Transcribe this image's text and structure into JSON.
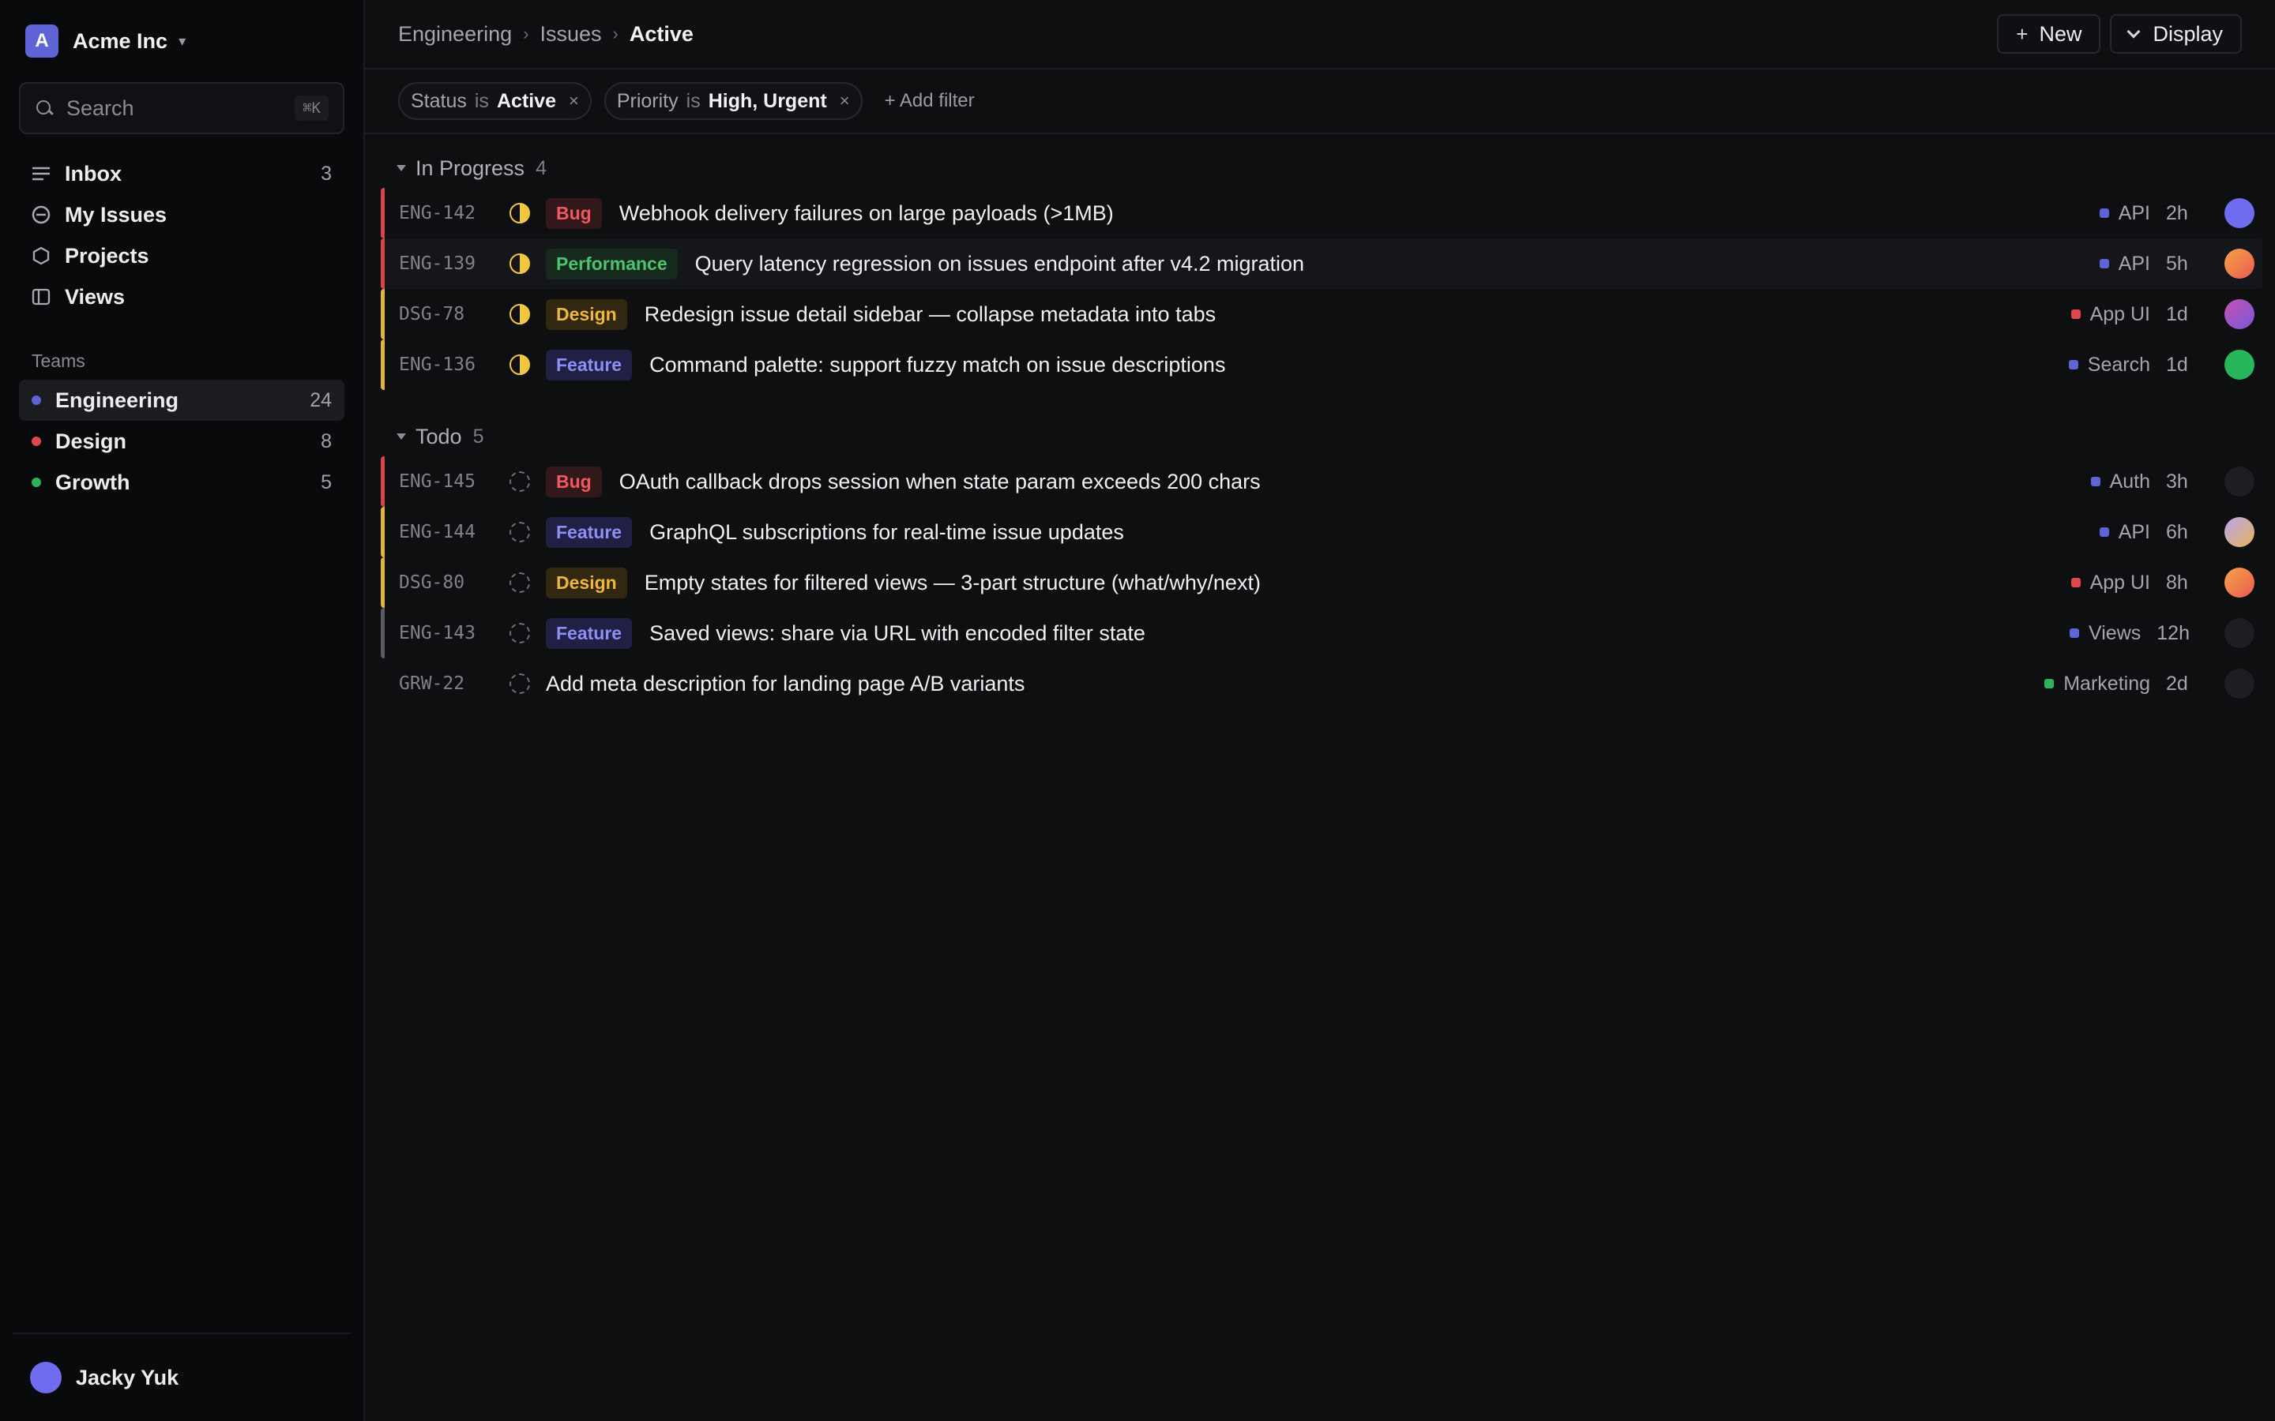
{
  "workspace": {
    "logo_letter": "A",
    "name": "Acme Inc"
  },
  "search": {
    "placeholder": "Search",
    "shortcut": "⌘K"
  },
  "nav": [
    {
      "label": "Inbox",
      "count": "3",
      "icon": "inbox-icon"
    },
    {
      "label": "My Issues",
      "count": "",
      "icon": "my-issues-icon"
    },
    {
      "label": "Projects",
      "count": "",
      "icon": "projects-icon"
    },
    {
      "label": "Views",
      "count": "",
      "icon": "views-icon"
    }
  ],
  "teams": {
    "header": "Teams",
    "items": [
      {
        "label": "Engineering",
        "count": "24",
        "color": "#5e63d6",
        "active": true
      },
      {
        "label": "Design",
        "count": "8",
        "color": "#e0464e"
      },
      {
        "label": "Growth",
        "count": "5",
        "color": "#2eb35a"
      }
    ]
  },
  "user": {
    "name": "Jacky Yuk"
  },
  "breadcrumb": {
    "team": "Engineering",
    "section": "Issues",
    "current": "Active"
  },
  "toolbar": {
    "new_label": "New",
    "display_label": "Display"
  },
  "filters": [
    {
      "key": "Status",
      "op": "is",
      "value": "Active"
    },
    {
      "key": "Priority",
      "op": "is",
      "value": "High, Urgent"
    }
  ],
  "add_filter_label": "+ Add filter",
  "groups": [
    {
      "name": "In Progress",
      "count": "4",
      "issues": [
        {
          "id": "ENG-142",
          "tag": "Bug",
          "title": "Webhook delivery failures on large payloads (>1MB)",
          "project": "API",
          "project_color": "#5e63d6",
          "time": "2h"
        },
        {
          "id": "ENG-139",
          "tag": "Performance",
          "title": "Query latency regression on issues endpoint after v4.2 migration",
          "project": "API",
          "project_color": "#5e63d6",
          "time": "5h"
        },
        {
          "id": "DSG-78",
          "tag": "Design",
          "title": "Redesign issue detail sidebar — collapse metadata into tabs",
          "project": "App UI",
          "project_color": "#e0464e",
          "time": "1d"
        },
        {
          "id": "ENG-136",
          "tag": "Feature",
          "title": "Command palette: support fuzzy match on issue descriptions",
          "project": "Search",
          "project_color": "#5e63d6",
          "time": "1d"
        }
      ]
    },
    {
      "name": "Todo",
      "count": "5",
      "issues": [
        {
          "id": "ENG-145",
          "tag": "Bug",
          "title": "OAuth callback drops session when state param exceeds 200 chars",
          "project": "Auth",
          "project_color": "#5e63d6",
          "time": "3h"
        },
        {
          "id": "ENG-144",
          "tag": "Feature",
          "title": "GraphQL subscriptions for real-time issue updates",
          "project": "API",
          "project_color": "#5e63d6",
          "time": "6h"
        },
        {
          "id": "DSG-80",
          "tag": "Design",
          "title": "Empty states for filtered views — 3-part structure (what/why/next)",
          "project": "App UI",
          "project_color": "#e0464e",
          "time": "8h"
        },
        {
          "id": "ENG-143",
          "tag": "Feature",
          "title": "Saved views: share via URL with encoded filter state",
          "project": "Views",
          "project_color": "#5e63d6",
          "time": "12h"
        },
        {
          "id": "GRW-22",
          "tag": "",
          "title": "Add meta description for landing page A/B variants",
          "project": "Marketing",
          "project_color": "#2eb35a",
          "time": "2d"
        }
      ]
    }
  ]
}
